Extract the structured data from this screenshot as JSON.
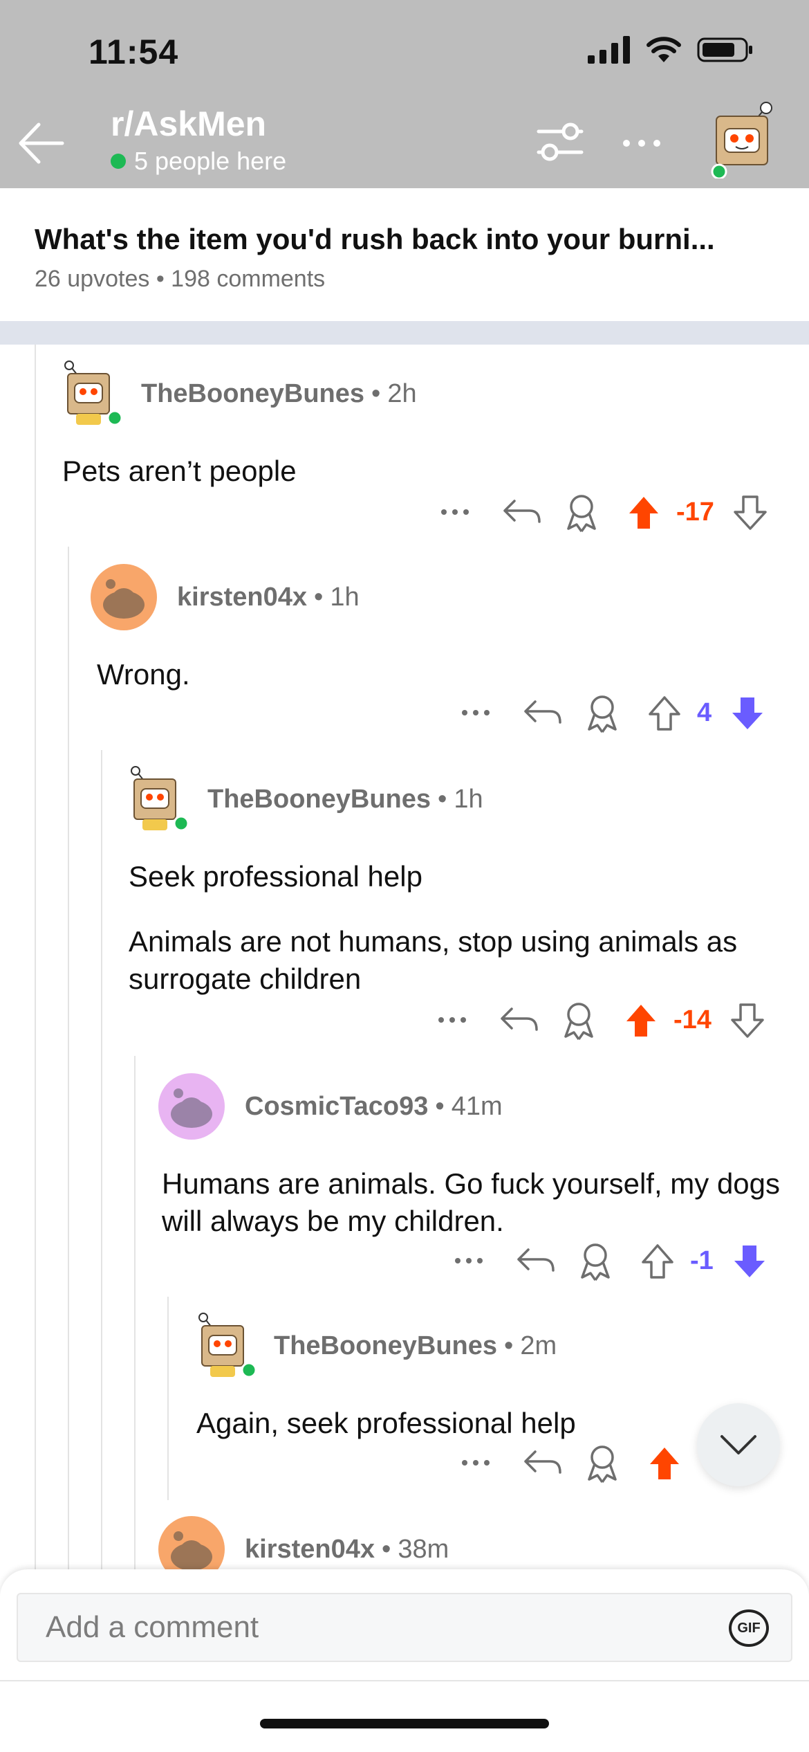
{
  "status_bar": {
    "time": "11:54"
  },
  "header": {
    "subreddit": "r/AskMen",
    "online_text": "5 people here",
    "icons": {
      "back": "back-arrow-icon",
      "filter": "sort-filter-icon",
      "more": "more-dots-icon"
    }
  },
  "post": {
    "title": "What's the item you'd rush back into your burni...",
    "upvotes": "26 upvotes",
    "comments": "198 comments"
  },
  "comments": [
    {
      "user": "TheBooneyBunes",
      "age": "2h",
      "body": [
        "Pets aren’t people"
      ],
      "score": "-17",
      "vote": "up",
      "avatar": "box-robot"
    },
    {
      "user": "kirsten04x",
      "age": "1h",
      "body": [
        "Wrong."
      ],
      "score": "4",
      "vote": "down",
      "avatar": "orange-snoo"
    },
    {
      "user": "TheBooneyBunes",
      "age": "1h",
      "body": [
        "Seek professional help",
        "Animals are not humans, stop using animals as surrogate children"
      ],
      "score": "-14",
      "vote": "up",
      "avatar": "box-robot"
    },
    {
      "user": "CosmicTaco93",
      "age": "41m",
      "body": [
        "Humans are animals. Go fuck yourself, my dogs will always be my children."
      ],
      "score": "-1",
      "vote": "down",
      "avatar": "purple-snoo"
    },
    {
      "user": "TheBooneyBunes",
      "age": "2m",
      "body": [
        "Again, seek professional help"
      ],
      "score": "",
      "vote": "up",
      "avatar": "box-robot"
    },
    {
      "user": "kirsten04x",
      "age": "38m",
      "body": [],
      "score": "",
      "vote": "none",
      "avatar": "orange-snoo"
    }
  ],
  "sep": "•",
  "composer": {
    "placeholder": "Add a comment",
    "gif_label": "GIF"
  },
  "colors": {
    "upvote": "#ff4500",
    "downvote": "#6a5cff",
    "online": "#1db954",
    "header_bg": "#bdbdbd"
  }
}
